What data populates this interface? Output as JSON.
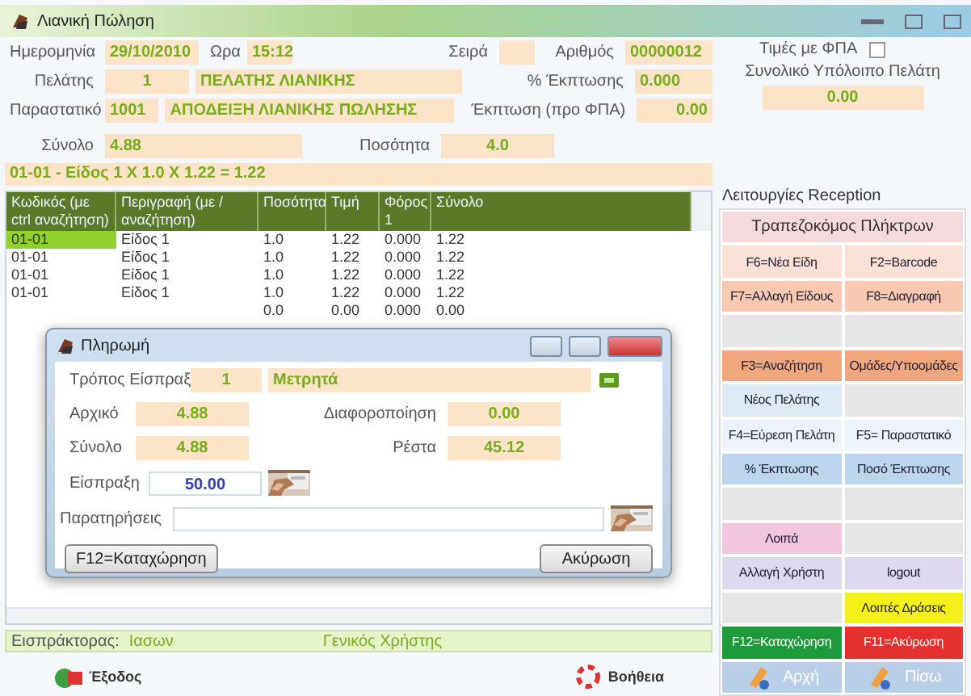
{
  "window": {
    "title": "Λιανική Πώληση"
  },
  "invoice": {
    "date_label": "Ημερομηνία",
    "date": "29/10/2010",
    "time_label": "Ωρα",
    "time": "15:12",
    "series_label": "Σειρά",
    "number_label": "Αριθμός",
    "number": "00000012",
    "customer_label": "Πελάτης",
    "customer_code": "1",
    "customer_name": "ΠΕΛΑΤΗΣ ΛΙΑΝΙΚΗΣ",
    "discount_pct_label": "% Έκπτωσης",
    "discount_pct": "0.000",
    "doc_label": "Παραστατικό",
    "doc_code": "1001",
    "doc_name": "ΑΠΟΔΕΙΞΗ ΛΙΑΝΙΚΗΣ ΠΩΛΗΣΗΣ",
    "discount_label": "Έκπτωση (προ ΦΠΑ)",
    "discount": "0.00",
    "total_label": "Σύνολο",
    "total": "4.88",
    "qty_label": "Ποσότητα",
    "qty": "4.0"
  },
  "vat_prices": {
    "label": "Τιμές με ΦΠΑ",
    "checked": false
  },
  "balance": {
    "label": "Συνολικό Υπόλοιπο Πελάτη",
    "value": "0.00"
  },
  "last_line": "01-01 - Είδος 1 X 1.0 X 1.22 = 1.22",
  "table": {
    "columns": [
      "Κωδικός (με ctrl αναζήτηση)",
      "Περιγραφή (με / αναζήτηση)",
      "Ποσότητα",
      "Τιμή",
      "Φόρος 1",
      "Σύνολο"
    ],
    "rows": [
      {
        "cells": [
          "01-01",
          "Είδος 1",
          "1.0",
          "1.22",
          "0.000",
          "1.22"
        ],
        "selected": true
      },
      {
        "cells": [
          "01-01",
          "Είδος 1",
          "1.0",
          "1.22",
          "0.000",
          "1.22"
        ],
        "selected": false
      },
      {
        "cells": [
          "01-01",
          "Είδος 1",
          "1.0",
          "1.22",
          "0.000",
          "1.22"
        ],
        "selected": false
      },
      {
        "cells": [
          "01-01",
          "Είδος 1",
          "1.0",
          "1.22",
          "0.000",
          "1.22"
        ],
        "selected": false
      },
      {
        "cells": [
          "",
          "",
          "0.0",
          "0.00",
          "0.000",
          "0.00"
        ],
        "selected": false
      }
    ]
  },
  "dialog": {
    "title": "Πληρωμή",
    "method_label": "Τρόπος Είσπραξ",
    "method_code": "1",
    "method_name": "Μετρητά",
    "initial_label": "Αρχικό",
    "initial": "4.88",
    "adjust_label": "Διαφοροποίηση",
    "adjust": "0.00",
    "total_label": "Σύνολο",
    "total": "4.88",
    "change_label": "Ρέστα",
    "change": "45.12",
    "received_label": "Είσπραξη",
    "received": "50.00",
    "notes_label": "Παρατηρήσεις",
    "buttons": [
      "F12=Καταχώρηση",
      "Ακύρωση"
    ]
  },
  "functions": {
    "title": "Λειτουργίες Reception",
    "header": "Τραπεζοκόμος Πλήκτρων",
    "buttons": [
      {
        "kind": "button",
        "label": "F6=Νέα Είδη",
        "color": "#fbe0d6"
      },
      {
        "kind": "button",
        "label": "F2=Barcode",
        "color": "#fbe0d6"
      },
      {
        "kind": "button",
        "label": "F7=Αλλαγή Είδους",
        "color": "#f8c9b0"
      },
      {
        "kind": "button",
        "label": "F8=Διαγραφή",
        "color": "#f8c9b0"
      },
      {
        "kind": "blank"
      },
      {
        "kind": "blank"
      },
      {
        "kind": "button",
        "label": "F3=Αναζήτηση",
        "color": "#f0a77e"
      },
      {
        "kind": "button",
        "label": "Ομάδες/Υποομάδες",
        "color": "#f0a77e"
      },
      {
        "kind": "button",
        "label": "Νέος Πελάτης",
        "color": "#dde9f5"
      },
      {
        "kind": "blank"
      },
      {
        "kind": "button",
        "label": "F4=Εύρεση Πελάτη",
        "color": "#edf3fa"
      },
      {
        "kind": "button",
        "label": "F5= Παραστατικό",
        "color": "#edf3fa"
      },
      {
        "kind": "button",
        "label": "% Έκπτωσης",
        "color": "#bcd6ee"
      },
      {
        "kind": "button",
        "label": "Ποσό Έκπτωσης",
        "color": "#bcd6ee"
      },
      {
        "kind": "blank"
      },
      {
        "kind": "blank"
      },
      {
        "kind": "button",
        "label": "Λοιπά",
        "color": "#f2c6de"
      },
      {
        "kind": "blank"
      },
      {
        "kind": "button",
        "label": "Αλλαγή Χρήστη",
        "color": "#ded9ee"
      },
      {
        "kind": "button",
        "label": "logout",
        "color": "#ded9ee"
      },
      {
        "kind": "blank"
      },
      {
        "kind": "button",
        "label": "Λοιπές Δράσεις",
        "color": "#f6f01a"
      },
      {
        "kind": "button",
        "label": "F12=Καταχώρηση",
        "color": "#1f9a3a"
      },
      {
        "kind": "button",
        "label": "F11=Ακύρωση",
        "color": "#e53030"
      },
      {
        "kind": "nav",
        "label": "Αρχή",
        "color": "#b9cfe8"
      },
      {
        "kind": "nav",
        "label": "Πίσω",
        "color": "#b9cfe8"
      }
    ]
  },
  "status": {
    "label": "Εισπράκτορας:",
    "user": "Ιασων",
    "role": "Γενικός Χρήστης"
  },
  "footer": {
    "exit": "Έξοδος",
    "help": "Βοήθεια"
  }
}
